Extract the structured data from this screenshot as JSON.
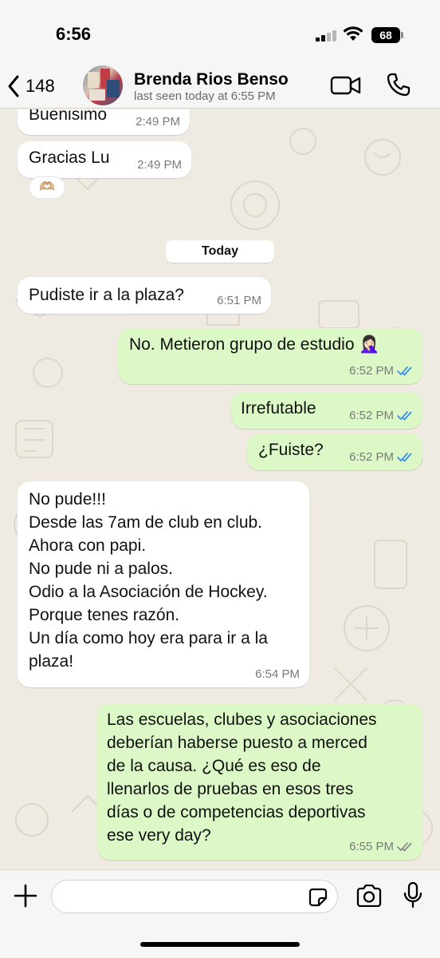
{
  "status_bar": {
    "time": "6:56",
    "battery": "68"
  },
  "header": {
    "back_count": "148",
    "contact_name": "Brenda Rios Benso",
    "contact_status": "last seen today at 6:55 PM"
  },
  "chat": {
    "day_separator": "Today",
    "messages": [
      {
        "direction": "in",
        "text": "Buenisimo",
        "time": "2:49 PM"
      },
      {
        "direction": "in",
        "text": "Gracias Lu",
        "time": "2:49 PM",
        "reaction": "🫶🏼"
      },
      {
        "direction": "in",
        "text": "Pudiste ir a la plaza?",
        "time": "6:51 PM"
      },
      {
        "direction": "out",
        "text": "No. Metieron grupo de estudio 🤦🏻‍♀️",
        "time": "6:52 PM",
        "status": "read"
      },
      {
        "direction": "out",
        "text": "Irrefutable",
        "time": "6:52 PM",
        "status": "read"
      },
      {
        "direction": "out",
        "text": "¿Fuiste?",
        "time": "6:52 PM",
        "status": "read"
      },
      {
        "direction": "in",
        "text": "No pude!!!\nDesde las 7am de club en club.\nAhora con papi.\nNo pude ni a palos.\nOdio a la Asociación de Hockey.\nPorque tenes razón.\nUn día como hoy era para ir a la\nplaza!",
        "time": "6:54 PM"
      },
      {
        "direction": "out",
        "text": "Las escuelas, clubes y asociaciones\ndeberían haberse puesto a merced\nde la causa. ¿Qué es eso de\nllenarlos de pruebas en esos tres\ndías o de competencias deportivas\nese very day?",
        "time": "6:55 PM",
        "status": "delivered"
      }
    ]
  },
  "input": {
    "placeholder": ""
  },
  "colors": {
    "chat_background": "#efeae2",
    "outgoing_bubble": "#dbf8c6",
    "incoming_bubble": "#ffffff",
    "read_tick": "#3a8ff0",
    "delivered_tick": "#8a8a8a"
  },
  "icons": [
    "back-chevron-icon",
    "video-call-icon",
    "phone-icon",
    "plus-icon",
    "sticker-icon",
    "camera-icon",
    "mic-icon"
  ]
}
